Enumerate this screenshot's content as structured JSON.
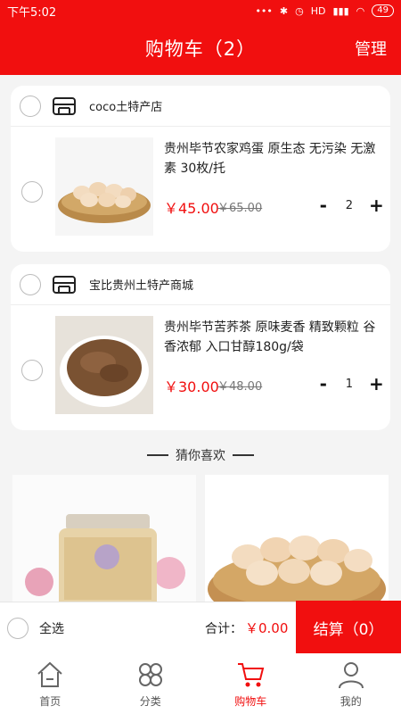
{
  "status_bar": {
    "time": "下午5:02",
    "signal_text": "HD",
    "battery": "49"
  },
  "header": {
    "title": "购物车（2）",
    "manage": "管理"
  },
  "shops": [
    {
      "name": "coco土特产店",
      "item": {
        "title": "贵州毕节农家鸡蛋 原生态 无污染 无激素 30枚/托",
        "price": "￥45.00",
        "old_price": "￥65.00",
        "qty": "2",
        "image": "eggs-basket"
      }
    },
    {
      "name": "宝比贵州土特产商城",
      "item": {
        "title": "贵州毕节苦荞茶 原味麦香 精致颗粒 谷香浓郁 入口甘醇180g/袋",
        "price": "￥30.00",
        "old_price": "￥48.00",
        "qty": "1",
        "image": "buckwheat-tea"
      }
    }
  ],
  "recommend": {
    "title": "猜你喜欢",
    "items": [
      {
        "image": "honey-jar"
      },
      {
        "image": "eggs-basket"
      }
    ]
  },
  "checkout": {
    "select_all": "全选",
    "total_label": "合计：",
    "total_value": "￥0.00",
    "settle": "结算（0）"
  },
  "tabbar": [
    {
      "label": "首页",
      "icon": "home-icon"
    },
    {
      "label": "分类",
      "icon": "category-icon"
    },
    {
      "label": "购物车",
      "icon": "cart-icon"
    },
    {
      "label": "我的",
      "icon": "user-icon"
    }
  ],
  "colors": {
    "accent": "#f10f0f",
    "background": "#f4f4f4"
  }
}
